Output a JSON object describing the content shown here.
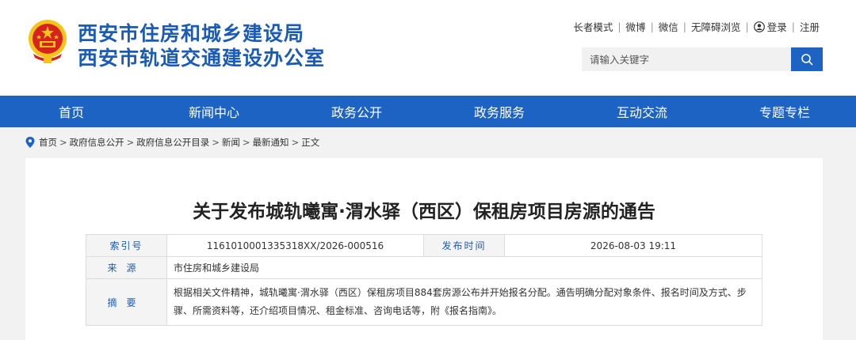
{
  "header": {
    "org_line1": "西安市住房和城乡建设局",
    "org_line2": "西安市轨道交通建设办公室",
    "colors": {
      "brand_blue": "#1d63c3",
      "title_blue": "#1a5bb5",
      "emblem_red": "#d6231f",
      "emblem_gold": "#f6c419"
    }
  },
  "toplinks": {
    "elder_mode": "长者模式",
    "weibo": "微博",
    "wechat": "微信",
    "accessible": "无障碍浏览",
    "login": "登录",
    "register": "注册",
    "separator": "|"
  },
  "search": {
    "placeholder": "请输入关键字",
    "icon": "search-icon"
  },
  "nav": {
    "items": [
      "首页",
      "新闻中心",
      "政务公开",
      "政务服务",
      "互动交流",
      "专题专栏"
    ]
  },
  "breadcrumb": {
    "items": [
      "首页",
      "政府信息公开",
      "政府信息公开目录",
      "新闻",
      "最新通知",
      "正文"
    ],
    "separator": ">"
  },
  "article": {
    "title": "关于发布城轨曦寓·渭水驿（西区）保租房项目房源的通告",
    "meta": {
      "index_label": "索引号",
      "index_value": "1161010001335318XX/2026-000516",
      "publish_label": "发布时间",
      "publish_value": "2026-08-03 19:11",
      "source_label": "来源",
      "source_value": "市住房和城乡建设局",
      "summary_label": "摘要",
      "summary_value": "根据相关文件精神，城轨曦寓·渭水驿（西区）保租房项目884套房源公布并开始报名分配。通告明确分配对象条件、报名时间及方式、步骤、所需资料等，还介绍项目情况、租金标准、咨询电话等，附《报名指南》。"
    }
  }
}
